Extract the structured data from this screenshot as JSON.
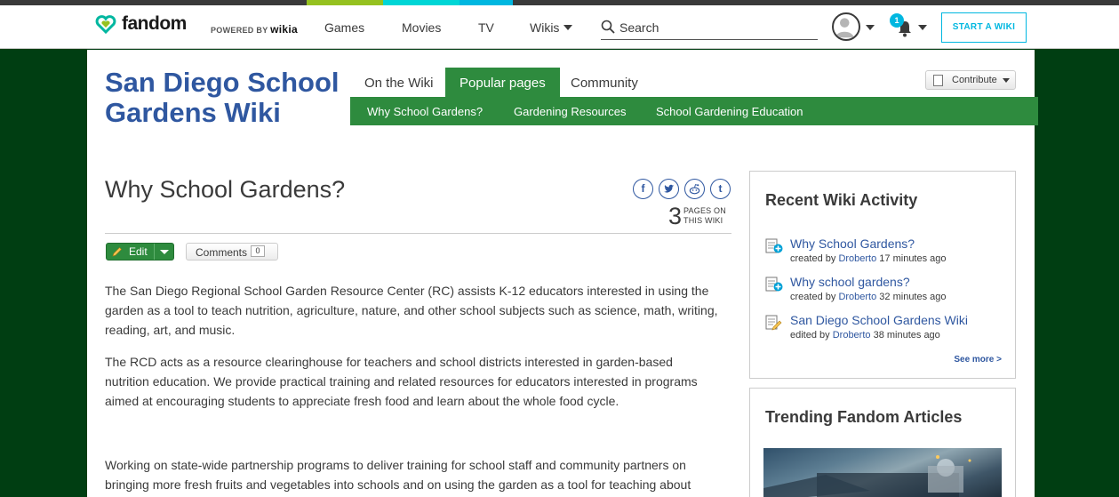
{
  "colors": {
    "accent_green": "#2e8b3e",
    "link_blue": "#2f57a0",
    "fandom_teal": "#00b7e0",
    "background": "#003e12",
    "stripe": [
      "#3a3a3a",
      "#95c11f",
      "#00d6d6",
      "#00b7e0",
      "#3a3a3a"
    ]
  },
  "topbar": {
    "logo_text": "fandom",
    "powered_prefix": "POWERED BY",
    "powered_brand": "wikia",
    "nav": [
      "Games",
      "Movies",
      "TV",
      "Wikis"
    ],
    "search_placeholder": "Search",
    "notification_count": "1",
    "start_wiki": "START A WIKI"
  },
  "wiki": {
    "title": "San Diego School Gardens Wiki",
    "tabs": [
      "On the Wiki",
      "Popular pages",
      "Community"
    ],
    "active_tab": "Popular pages",
    "subnav": [
      "Why School Gardens?",
      "Gardening Resources",
      "School Gardening Education"
    ],
    "contribute": "Contribute"
  },
  "article": {
    "title": "Why School Gardens?",
    "share_icons": [
      "facebook-icon",
      "twitter-icon",
      "reddit-icon",
      "tumblr-icon"
    ],
    "pages_count": "3",
    "pages_label_1": "PAGES ON",
    "pages_label_2": "THIS WIKI",
    "edit_label": "Edit",
    "comments_label": "Comments",
    "comments_count": "0",
    "paragraphs": [
      "The San Diego Regional School Garden Resource Center (RC) assists K-12 educators interested in using the garden as a tool to teach nutrition, agriculture, nature, and other school subjects such as science, math, writing, reading, art, and music.",
      "The RCD acts as a resource clearinghouse for teachers and school districts interested in garden-based nutrition education. We provide practical training and related resources for educators interested in programs aimed at encouraging students to appreciate fresh food and learn about the whole food cycle.",
      "Working on state-wide partnership programs to deliver training for school staff and community partners on bringing more fresh fruits and vegetables into schools and on using the garden as a tool for teaching about"
    ]
  },
  "rail": {
    "activity_heading": "Recent Wiki Activity",
    "activity": [
      {
        "title": "Why School Gardens?",
        "action": "created by",
        "user": "Droberto",
        "time": "17 minutes ago",
        "icon": "new-page-icon"
      },
      {
        "title": "Why school gardens?",
        "action": "created by",
        "user": "Droberto",
        "time": "32 minutes ago",
        "icon": "new-page-icon"
      },
      {
        "title": "San Diego School Gardens Wiki",
        "action": "edited by",
        "user": "Droberto",
        "time": "38 minutes ago",
        "icon": "edit-page-icon"
      }
    ],
    "see_more": "See more >",
    "trending_heading": "Trending Fandom Articles"
  }
}
